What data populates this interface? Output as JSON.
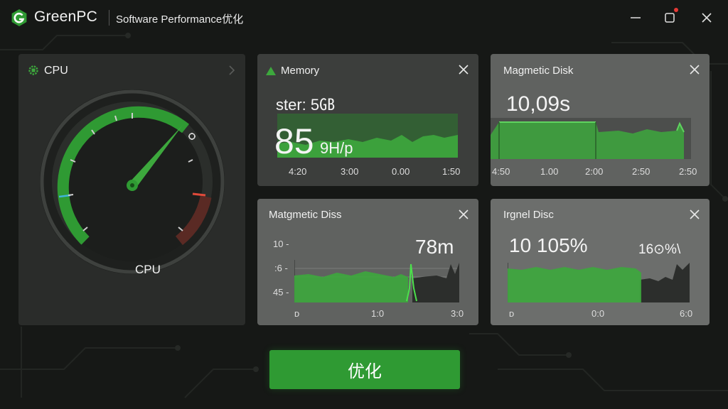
{
  "titlebar": {
    "app_name": "GreenPC",
    "subtitle": "Software Performance优化"
  },
  "cpu_panel": {
    "title": "CPU",
    "gauge_label": "CPU"
  },
  "memory_card": {
    "title": "Memory",
    "top_value": "ster: 5㎇",
    "big_value": "85",
    "unit": "9H/p",
    "x_ticks": [
      "4:20",
      "3:00",
      "0.00",
      "1:50"
    ]
  },
  "disk_card_1": {
    "title": "Magmetic Disk",
    "big_value": "10,09s",
    "x_ticks": [
      "4:50",
      "1.00",
      "2:00",
      "2:50",
      "2:50"
    ]
  },
  "disk_card_2": {
    "title": "Matgmetic Diss",
    "value": "78m",
    "y_ticks": [
      "10 -",
      ":6 -",
      "45 -"
    ],
    "x_ticks": [
      "ᴅ",
      "1:0",
      "3:0"
    ]
  },
  "disk_card_3": {
    "title": "Irgnel Disc",
    "value_left": "10 105%",
    "value_right": "16⊙%\\",
    "x_ticks": [
      "ᴅ",
      "0:0",
      "6:0"
    ]
  },
  "action": {
    "optimize_label": "优化"
  },
  "colors": {
    "accent_green": "#2f9a33",
    "chart_green": "#3da83d",
    "gauge_red": "#c0392b",
    "gauge_cyan": "#3fb5d8"
  },
  "icons": {
    "logo": "greenpc-logo-icon",
    "cpu": "gear-chip-icon",
    "memory": "triangle-up-icon",
    "close": "close-icon",
    "minimize": "minimize-icon",
    "maximize": "maximize-icon"
  }
}
